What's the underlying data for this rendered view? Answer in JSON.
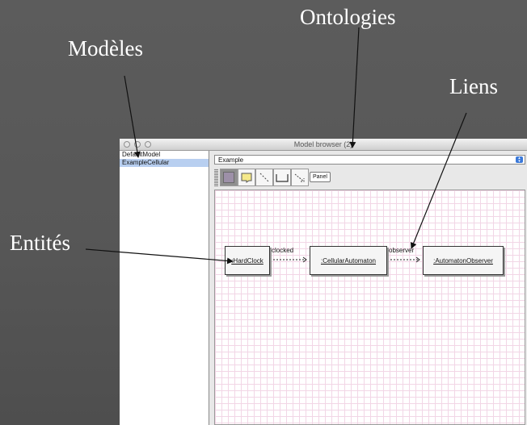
{
  "annotations": {
    "ontologies": "Ontologies",
    "modeles": "Modèles",
    "liens": "Liens",
    "entites": "Entités"
  },
  "window": {
    "title": "Model browser (2)",
    "models": [
      {
        "label": "DefaultModel",
        "selected": false
      },
      {
        "label": "ExampleCellular",
        "selected": true
      }
    ],
    "ontology_select": {
      "value": "Example"
    },
    "toolbar": {
      "panel_label": "Panel"
    },
    "diagram": {
      "entities": [
        ":HardClock",
        ":CellularAutomaton",
        ":AutomatonObserver"
      ],
      "links": [
        "clocked",
        "observer"
      ]
    }
  }
}
